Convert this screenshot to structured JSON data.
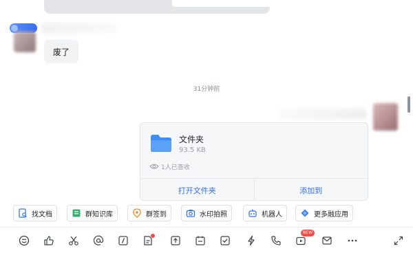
{
  "messages": {
    "left_message_text": "废了",
    "timestamp": "31分钟前"
  },
  "file_card": {
    "file_name": "文件夹",
    "file_size": "93.5 KB",
    "seen_text": "1人已查收",
    "open_label": "打开文件夹",
    "add_label": "添加到"
  },
  "quick_actions": [
    {
      "label": "找文档",
      "icon": "doc-search-icon"
    },
    {
      "label": "群知识库",
      "icon": "knowledge-base-icon"
    },
    {
      "label": "群签到",
      "icon": "checkin-icon"
    },
    {
      "label": "水印拍照",
      "icon": "camera-icon"
    },
    {
      "label": "机器人",
      "icon": "robot-icon"
    },
    {
      "label": "更多融应用",
      "icon": "apps-icon"
    }
  ],
  "toolbar": {
    "new_badge": "NEW",
    "tools": [
      "emoji-icon",
      "thumbs-up-icon",
      "scissors-icon",
      "mention-icon",
      "italic-icon",
      "task-icon",
      "send-file-icon",
      "calendar-icon",
      "checklist-icon",
      "lightning-icon",
      "phone-icon",
      "video-icon",
      "mail-icon",
      "more-icon",
      "expand-icon"
    ]
  },
  "colors": {
    "accent": "#3370ff",
    "badge_red": "#f54a45",
    "folder_blue": "#3e8df5"
  }
}
